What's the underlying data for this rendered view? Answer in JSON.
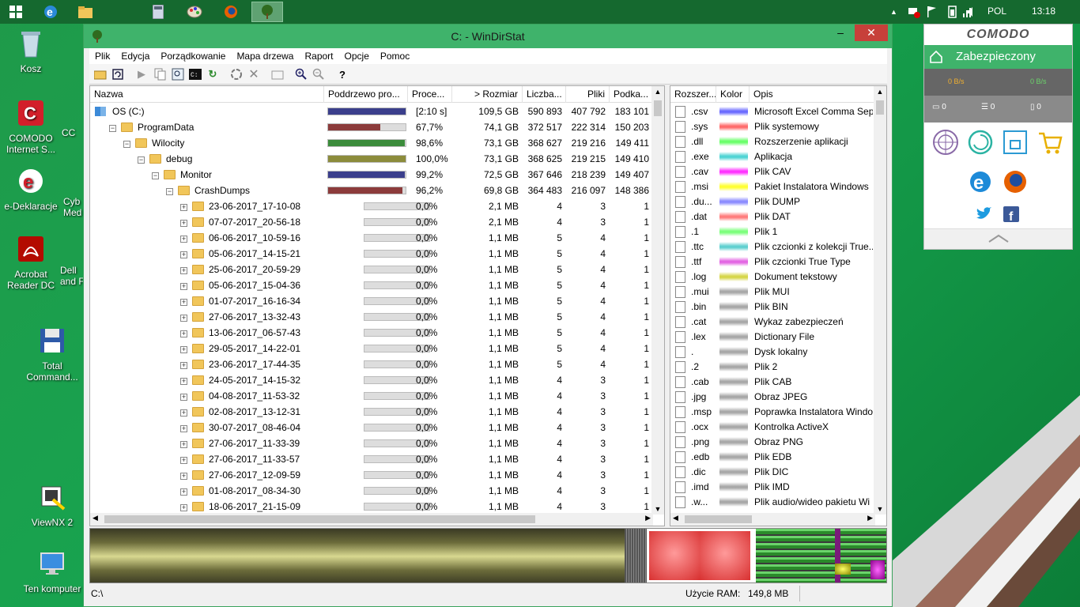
{
  "taskbar": {
    "tray": {
      "language": "POL",
      "time": "13:18"
    }
  },
  "desktop": {
    "icons": [
      {
        "label": "Kosz",
        "icon": "recycle-bin-icon"
      },
      {
        "label": "COMODO Internet S...",
        "icon": "comodo-icon"
      },
      {
        "label": "e-Deklaracje",
        "icon": "e-deklaracje-icon"
      },
      {
        "label": "Acrobat Reader DC",
        "icon": "acrobat-icon"
      },
      {
        "label": "Total Command...",
        "icon": "floppy-icon"
      },
      {
        "label": "ViewNX 2",
        "icon": "viewnx-icon"
      },
      {
        "label": "Ten komputer",
        "icon": "computer-icon"
      }
    ],
    "partial_icons": [
      "CC",
      "Cyb Med",
      "Dell and F"
    ]
  },
  "window": {
    "title": "C: - WinDirStat",
    "menu": [
      "Plik",
      "Edycja",
      "Porządkowanie",
      "Mapa drzewa",
      "Raport",
      "Opcje",
      "Pomoc"
    ],
    "columns": [
      "Nazwa",
      "Poddrzewo pro...",
      "Proce...",
      "> Rozmiar",
      "Liczba...",
      "Pliki",
      "Podka..."
    ],
    "rows": [
      {
        "name": "OS (C:)",
        "level": 0,
        "kind": "drive",
        "pct_fill": 1.0,
        "color": "#3b3f8c",
        "percent": "[2:10 s]",
        "size": "109,5 GB",
        "items": "590 893",
        "files": "407 792",
        "subdirs": "183 101"
      },
      {
        "name": "ProgramData",
        "level": 1,
        "kind": "open",
        "pct_fill": 0.677,
        "color": "#8c3b3b",
        "percent": "67,7%",
        "size": "74,1 GB",
        "items": "372 517",
        "files": "222 314",
        "subdirs": "150 203"
      },
      {
        "name": "Wilocity",
        "level": 2,
        "kind": "open",
        "pct_fill": 0.986,
        "color": "#3b8c3b",
        "percent": "98,6%",
        "size": "73,1 GB",
        "items": "368 627",
        "files": "219 216",
        "subdirs": "149 411"
      },
      {
        "name": "debug",
        "level": 3,
        "kind": "open",
        "pct_fill": 1.0,
        "color": "#8c8c3b",
        "percent": "100,0%",
        "size": "73,1 GB",
        "items": "368 625",
        "files": "219 215",
        "subdirs": "149 410"
      },
      {
        "name": "Monitor",
        "level": 4,
        "kind": "open",
        "pct_fill": 0.992,
        "color": "#3b3f8c",
        "percent": "99,2%",
        "size": "72,5 GB",
        "items": "367 646",
        "files": "218 239",
        "subdirs": "149 407"
      },
      {
        "name": "CrashDumps",
        "level": 5,
        "kind": "open",
        "pct_fill": 0.962,
        "color": "#8c3b3b",
        "percent": "96,2%",
        "size": "69,8 GB",
        "items": "364 483",
        "files": "216 097",
        "subdirs": "148 386"
      },
      {
        "name": "23-06-2017_17-10-08",
        "level": 6,
        "kind": "closed",
        "pct_fill": 0,
        "color": "#aaaaaa",
        "percent": "0,0%",
        "size": "2,1 MB",
        "items": "4",
        "files": "3",
        "subdirs": "1"
      },
      {
        "name": "07-07-2017_20-56-18",
        "level": 6,
        "kind": "closed",
        "pct_fill": 0,
        "color": "#aaaaaa",
        "percent": "0,0%",
        "size": "2,1 MB",
        "items": "4",
        "files": "3",
        "subdirs": "1"
      },
      {
        "name": "06-06-2017_10-59-16",
        "level": 6,
        "kind": "closed",
        "pct_fill": 0,
        "color": "#aaaaaa",
        "percent": "0,0%",
        "size": "1,1 MB",
        "items": "5",
        "files": "4",
        "subdirs": "1"
      },
      {
        "name": "05-06-2017_14-15-21",
        "level": 6,
        "kind": "closed",
        "pct_fill": 0,
        "color": "#aaaaaa",
        "percent": "0,0%",
        "size": "1,1 MB",
        "items": "5",
        "files": "4",
        "subdirs": "1"
      },
      {
        "name": "25-06-2017_20-59-29",
        "level": 6,
        "kind": "closed",
        "pct_fill": 0,
        "color": "#aaaaaa",
        "percent": "0,0%",
        "size": "1,1 MB",
        "items": "5",
        "files": "4",
        "subdirs": "1"
      },
      {
        "name": "05-06-2017_15-04-36",
        "level": 6,
        "kind": "closed",
        "pct_fill": 0,
        "color": "#aaaaaa",
        "percent": "0,0%",
        "size": "1,1 MB",
        "items": "5",
        "files": "4",
        "subdirs": "1"
      },
      {
        "name": "01-07-2017_16-16-34",
        "level": 6,
        "kind": "closed",
        "pct_fill": 0,
        "color": "#aaaaaa",
        "percent": "0,0%",
        "size": "1,1 MB",
        "items": "5",
        "files": "4",
        "subdirs": "1"
      },
      {
        "name": "27-06-2017_13-32-43",
        "level": 6,
        "kind": "closed",
        "pct_fill": 0,
        "color": "#aaaaaa",
        "percent": "0,0%",
        "size": "1,1 MB",
        "items": "5",
        "files": "4",
        "subdirs": "1"
      },
      {
        "name": "13-06-2017_06-57-43",
        "level": 6,
        "kind": "closed",
        "pct_fill": 0,
        "color": "#aaaaaa",
        "percent": "0,0%",
        "size": "1,1 MB",
        "items": "5",
        "files": "4",
        "subdirs": "1"
      },
      {
        "name": "29-05-2017_14-22-01",
        "level": 6,
        "kind": "closed",
        "pct_fill": 0,
        "color": "#aaaaaa",
        "percent": "0,0%",
        "size": "1,1 MB",
        "items": "5",
        "files": "4",
        "subdirs": "1"
      },
      {
        "name": "23-06-2017_17-44-35",
        "level": 6,
        "kind": "closed",
        "pct_fill": 0,
        "color": "#aaaaaa",
        "percent": "0,0%",
        "size": "1,1 MB",
        "items": "5",
        "files": "4",
        "subdirs": "1"
      },
      {
        "name": "24-05-2017_14-15-32",
        "level": 6,
        "kind": "closed",
        "pct_fill": 0,
        "color": "#aaaaaa",
        "percent": "0,0%",
        "size": "1,1 MB",
        "items": "4",
        "files": "3",
        "subdirs": "1"
      },
      {
        "name": "04-08-2017_11-53-32",
        "level": 6,
        "kind": "closed",
        "pct_fill": 0,
        "color": "#aaaaaa",
        "percent": "0,0%",
        "size": "1,1 MB",
        "items": "4",
        "files": "3",
        "subdirs": "1"
      },
      {
        "name": "02-08-2017_13-12-31",
        "level": 6,
        "kind": "closed",
        "pct_fill": 0,
        "color": "#aaaaaa",
        "percent": "0,0%",
        "size": "1,1 MB",
        "items": "4",
        "files": "3",
        "subdirs": "1"
      },
      {
        "name": "30-07-2017_08-46-04",
        "level": 6,
        "kind": "closed",
        "pct_fill": 0,
        "color": "#aaaaaa",
        "percent": "0,0%",
        "size": "1,1 MB",
        "items": "4",
        "files": "3",
        "subdirs": "1"
      },
      {
        "name": "27-06-2017_11-33-39",
        "level": 6,
        "kind": "closed",
        "pct_fill": 0,
        "color": "#aaaaaa",
        "percent": "0,0%",
        "size": "1,1 MB",
        "items": "4",
        "files": "3",
        "subdirs": "1"
      },
      {
        "name": "27-06-2017_11-33-57",
        "level": 6,
        "kind": "closed",
        "pct_fill": 0,
        "color": "#aaaaaa",
        "percent": "0,0%",
        "size": "1,1 MB",
        "items": "4",
        "files": "3",
        "subdirs": "1"
      },
      {
        "name": "27-06-2017_12-09-59",
        "level": 6,
        "kind": "closed",
        "pct_fill": 0,
        "color": "#aaaaaa",
        "percent": "0,0%",
        "size": "1,1 MB",
        "items": "4",
        "files": "3",
        "subdirs": "1"
      },
      {
        "name": "01-08-2017_08-34-30",
        "level": 6,
        "kind": "closed",
        "pct_fill": 0,
        "color": "#aaaaaa",
        "percent": "0,0%",
        "size": "1,1 MB",
        "items": "4",
        "files": "3",
        "subdirs": "1"
      },
      {
        "name": "18-06-2017_21-15-09",
        "level": 6,
        "kind": "closed",
        "pct_fill": 0,
        "color": "#aaaaaa",
        "percent": "0,0%",
        "size": "1,1 MB",
        "items": "4",
        "files": "3",
        "subdirs": "1"
      }
    ],
    "ext_columns": [
      "Rozszer...",
      "Kolor",
      "Opis"
    ],
    "extensions": [
      {
        "ext": ".csv",
        "color": "#6b6bff",
        "desc": "Microsoft Excel Comma Sep"
      },
      {
        "ext": ".sys",
        "color": "#ff6b6b",
        "desc": "Plik systemowy"
      },
      {
        "ext": ".dll",
        "color": "#6bff6b",
        "desc": "Rozszerzenie aplikacji"
      },
      {
        "ext": ".exe",
        "color": "#4fd4d4",
        "desc": "Aplikacja"
      },
      {
        "ext": ".cav",
        "color": "#ff33ff",
        "desc": "Plik CAV"
      },
      {
        "ext": ".msi",
        "color": "#ffff33",
        "desc": "Pakiet Instalatora Windows"
      },
      {
        "ext": ".du...",
        "color": "#8c8cff",
        "desc": "Plik DUMP"
      },
      {
        "ext": ".dat",
        "color": "#ff7c7c",
        "desc": "Plik DAT"
      },
      {
        "ext": ".1",
        "color": "#7cff7c",
        "desc": "Plik 1"
      },
      {
        "ext": ".ttc",
        "color": "#5fd0d0",
        "desc": "Plik czcionki z kolekcji True..."
      },
      {
        "ext": ".ttf",
        "color": "#e366e3",
        "desc": "Plik czcionki True Type"
      },
      {
        "ext": ".log",
        "color": "#d6d64a",
        "desc": "Dokument tekstowy"
      },
      {
        "ext": ".mui",
        "color": "#a8a8a8",
        "desc": "Plik MUI"
      },
      {
        "ext": ".bin",
        "color": "#a8a8a8",
        "desc": "Plik BIN"
      },
      {
        "ext": ".cat",
        "color": "#a8a8a8",
        "desc": "Wykaz zabezpieczeń"
      },
      {
        "ext": ".lex",
        "color": "#a8a8a8",
        "desc": "Dictionary File"
      },
      {
        "ext": ".",
        "color": "#a8a8a8",
        "desc": "Dysk lokalny"
      },
      {
        "ext": ".2",
        "color": "#a8a8a8",
        "desc": "Plik 2"
      },
      {
        "ext": ".cab",
        "color": "#a8a8a8",
        "desc": "Plik CAB"
      },
      {
        "ext": ".jpg",
        "color": "#a8a8a8",
        "desc": "Obraz JPEG"
      },
      {
        "ext": ".msp",
        "color": "#a8a8a8",
        "desc": "Poprawka Instalatora Windo"
      },
      {
        "ext": ".ocx",
        "color": "#a8a8a8",
        "desc": "Kontrolka ActiveX"
      },
      {
        "ext": ".png",
        "color": "#a8a8a8",
        "desc": "Obraz PNG"
      },
      {
        "ext": ".edb",
        "color": "#a8a8a8",
        "desc": "Plik EDB"
      },
      {
        "ext": ".dic",
        "color": "#a8a8a8",
        "desc": "Plik DIC"
      },
      {
        "ext": ".imd",
        "color": "#a8a8a8",
        "desc": "Plik IMD"
      },
      {
        "ext": ".w...",
        "color": "#a8a8a8",
        "desc": "Plik audio/wideo pakietu Wi"
      }
    ],
    "status": {
      "path": "C:\\",
      "ram_label": "Użycie RAM:",
      "ram_value": "149,8 MB"
    }
  },
  "comodo": {
    "brand": "COMODO",
    "state": "Zabezpieczony",
    "speed_down": "0 B/s",
    "speed_up": "0 B/s",
    "counters": [
      "0",
      "0",
      "0"
    ]
  }
}
